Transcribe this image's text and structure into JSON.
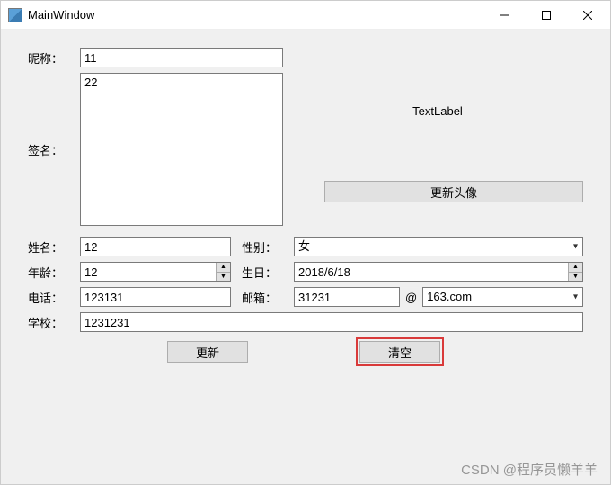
{
  "window": {
    "title": "MainWindow"
  },
  "labels": {
    "nickname": "昵称：",
    "signature": "签名：",
    "name": "姓名：",
    "gender": "性别：",
    "age": "年龄：",
    "birthday": "生日：",
    "phone": "电话：",
    "email": "邮箱：",
    "school": "学校：",
    "avatar_text": "TextLabel"
  },
  "values": {
    "nickname": "11",
    "signature": "22",
    "name": "12",
    "gender": "女",
    "age": "12",
    "birthday": "2018/6/18",
    "phone": "123131",
    "email_user": "31231",
    "email_at": "@",
    "email_domain": "163.com",
    "school": "1231231"
  },
  "buttons": {
    "update_avatar": "更新头像",
    "update": "更新",
    "clear": "清空"
  },
  "watermark": "CSDN @程序员懒羊羊"
}
